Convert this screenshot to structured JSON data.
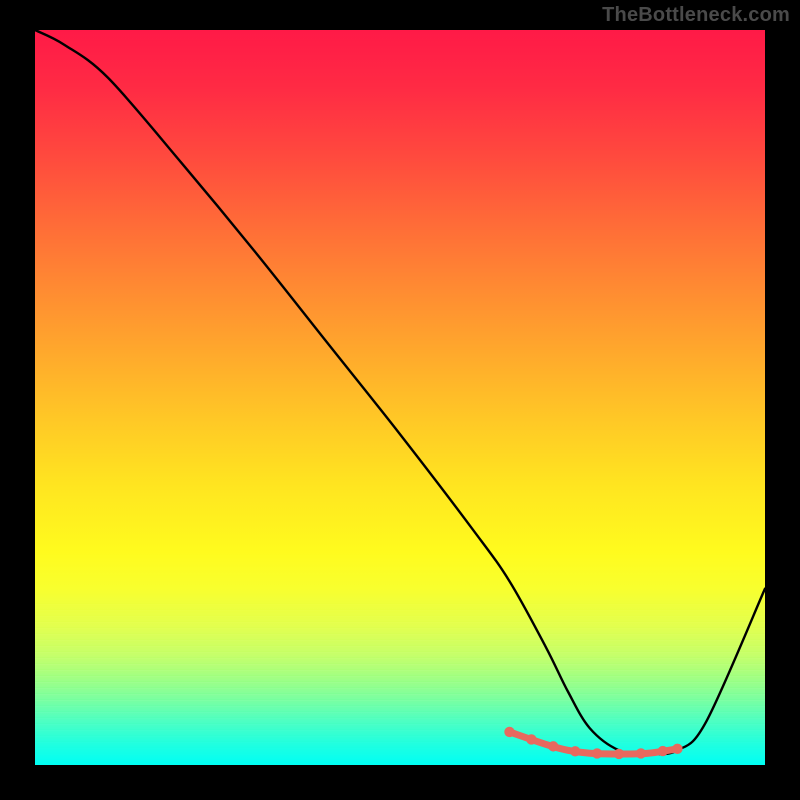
{
  "watermark": "TheBottleneck.com",
  "chart_data": {
    "type": "line",
    "title": "",
    "xlabel": "",
    "ylabel": "",
    "axes_visible": false,
    "ylim": [
      0,
      100
    ],
    "xlim": [
      0,
      100
    ],
    "x": [
      0,
      4,
      10,
      20,
      30,
      40,
      50,
      60,
      65,
      70,
      73,
      76,
      80,
      84,
      88,
      92,
      100
    ],
    "values": [
      100,
      98,
      93.5,
      82,
      70,
      57.5,
      45,
      32,
      25,
      16,
      10,
      5,
      2,
      1.5,
      2,
      6,
      24
    ],
    "highlight_segment": {
      "x": [
        65,
        70,
        73,
        76,
        80,
        84,
        88
      ],
      "values": [
        4.5,
        2.8,
        2.0,
        1.6,
        1.5,
        1.6,
        2.2
      ]
    },
    "highlight_dots_x": [
      65,
      68,
      71,
      74,
      77,
      80,
      83,
      86,
      88
    ],
    "background_gradient": {
      "top": "#ff1a47",
      "mid": "#ffe520",
      "bottom": "#00fff4"
    }
  }
}
